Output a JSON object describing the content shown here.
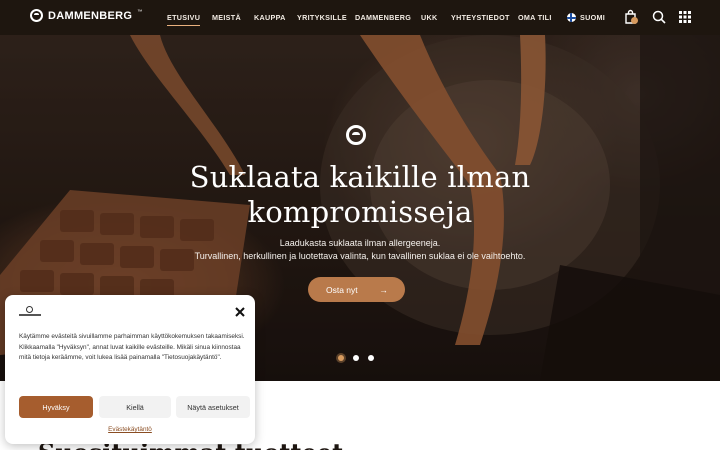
{
  "brand": {
    "name": "DAMMENBERG",
    "tm": "™"
  },
  "nav": {
    "items": [
      {
        "label": "ETUSIVU",
        "active": true
      },
      {
        "label": "MEISTÄ"
      },
      {
        "label": "KAUPPA"
      },
      {
        "label": "YRITYKSILLE"
      },
      {
        "label": "DAMMENBERG"
      },
      {
        "label": "UKK"
      },
      {
        "label": "YHTEYSTIEDOT"
      },
      {
        "label": "OMA TILI"
      }
    ],
    "language": "SUOMI",
    "icons": [
      "shopping-bag-icon",
      "search-icon",
      "grid-menu-icon"
    ]
  },
  "hero": {
    "title_line1": "Suklaata kaikille ilman",
    "title_line2": "kompromisseja",
    "subtitle_line1": "Laadukasta suklaata ilman allergeeneja.",
    "subtitle_line2": "Turvallinen, herkullinen ja luotettava valinta, kun tavallinen suklaa ei ole vaihtoehto.",
    "cta_label": "Osta nyt",
    "cta_arrow": "→",
    "slides": 3,
    "active_slide": 1
  },
  "section": {
    "heading": "Suosituimmat tuotteet"
  },
  "cookie": {
    "text": "Käytämme evästeitä sivuillamme parhaimman käyttökokemuksen takaamiseksi. Klikkaamalla \"Hyväksyn\", annat luvat kaikille evästeille. Mikäli sinua kiinnostaa mitä tietoja keräämme, voit lukea lisää painamalla \"Tietosuojakäytäntö\".",
    "accept_label": "Hyväksy",
    "deny_label": "Kiellä",
    "settings_label": "Näytä asetukset",
    "policy_link": "Evästekäytäntö",
    "close_icon": "×"
  },
  "colors": {
    "nav_bg": "#1e160f",
    "accent": "#b97a4b",
    "accept_button": "#a65d2e",
    "active_dot": "#d79a5e"
  }
}
